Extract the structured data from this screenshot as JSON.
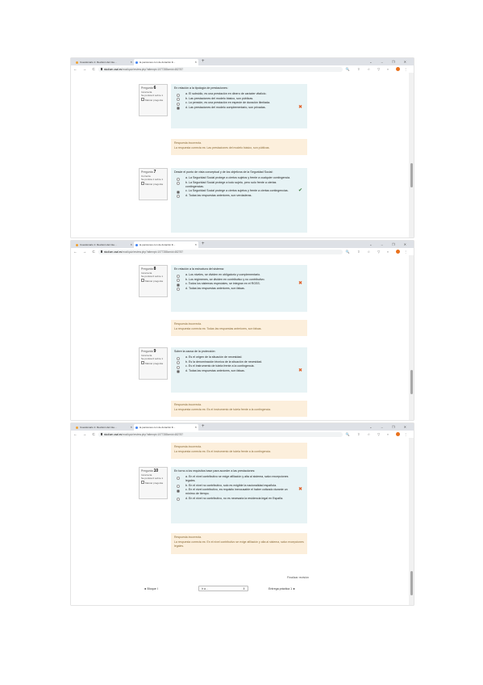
{
  "browser": {
    "tab1_title": "Cuestionario 1: Revisión del inte...",
    "tab2_title": "la pensiones con de duración ili...",
    "tab_close": "×",
    "new_tab": "+",
    "window_controls": "⌄  –  ❐  ✕",
    "nav_buttons": "←  →  C",
    "url_host": "studium.usal.es",
    "url_path": "/mod/quiz/review.php?attempt=1077288cmid=482787",
    "toolbar_icons": "🔍 ⇧ ☆ ▽ ▪"
  },
  "questions": [
    {
      "label": "Pregunta",
      "number": "6",
      "state": "Incorrecta",
      "score": "Se puntúa 0 sobre 1",
      "flag": "Marcar pregunta",
      "text": "En relación a la tipología de prestaciones:",
      "options": [
        {
          "letter": "a.",
          "text": "El subsidio, es una prestación en dinero de carácter vitalicio."
        },
        {
          "letter": "b.",
          "text": "Las prestaciones del modelo básico, son públicas."
        },
        {
          "letter": "c.",
          "text": "La pensión, es una prestación en especie de duración ilimitada."
        },
        {
          "letter": "d.",
          "text": "Las prestaciones del modelo complementario, son privadas.",
          "selected": true,
          "mark": "✖"
        }
      ],
      "feedback_title": "Respuesta incorrecta.",
      "feedback_text": "La respuesta correcta es: Las prestaciones del modelo básico, son públicas."
    },
    {
      "label": "Pregunta",
      "number": "7",
      "state": "Correcta",
      "score": "Se puntúa 1 sobre 1",
      "flag": "Marcar pregunta",
      "text": "Desde el punto de vista conceptual y de los objetivos de la Seguridad Social:",
      "options": [
        {
          "letter": "a.",
          "text": "La Seguridad Social protege a ciertos sujetos y frente a cualquier contingencia."
        },
        {
          "letter": "b.",
          "text": "La Seguridad Social protege a todo sujeto, pero solo frente a ciertas contingencias."
        },
        {
          "letter": "c.",
          "text": "La Seguridad Social protege a ciertos sujetos y frente a ciertas contingencias.",
          "selected": true,
          "mark": "✔"
        },
        {
          "letter": "d.",
          "text": "Todas las respuestas anteriores, son verdaderas."
        }
      ]
    },
    {
      "label": "Pregunta",
      "number": "8",
      "state": "Incorrecta",
      "score": "Se puntúa 0 sobre 1",
      "flag": "Marcar pregunta",
      "text": "En relación a la estructura del sistema:",
      "options": [
        {
          "letter": "a.",
          "text": "Los niveles, se dividen en obligatorio y complementario."
        },
        {
          "letter": "b.",
          "text": "Los regímenes, se dividen en contributivo y no contributivo."
        },
        {
          "letter": "c.",
          "text": "Todos los sistemas especiales, se integran en el RGSS.",
          "selected": true,
          "mark": "✖"
        },
        {
          "letter": "d.",
          "text": "Todas las respuestas anteriores, son falsas."
        }
      ],
      "feedback_title": "Respuesta incorrecta.",
      "feedback_text": "La respuesta correcta es: Todas las respuestas anteriores, son falsas."
    },
    {
      "label": "Pregunta",
      "number": "9",
      "state": "Incorrecta",
      "score": "Se puntúa 0 sobre 1",
      "flag": "Marcar pregunta",
      "text": "Sobre la causa de la protección:",
      "options": [
        {
          "letter": "a.",
          "text": "Es el origen de la situación de necesidad."
        },
        {
          "letter": "b.",
          "text": "Es la denominación técnica de la situación de necesidad."
        },
        {
          "letter": "c.",
          "text": "Es el instrumento de tutela frente a la contingencia."
        },
        {
          "letter": "d.",
          "text": "Todas las respuestas anteriores, son falsas.",
          "selected": true,
          "mark": "✖"
        }
      ],
      "feedback_title": "Respuesta incorrecta.",
      "feedback_text": "La respuesta correcta es: Es el instrumento de tutela frente a la contingencia."
    },
    {
      "label": "Pregunta",
      "number": "10",
      "state": "Incorrecta",
      "score": "Se puntúa 0 sobre 1",
      "flag": "Marcar pregunta",
      "text": "En torno a los requisitos base para acceder a las prestaciones:",
      "options": [
        {
          "letter": "a.",
          "text": "En el nivel contributivo se exige afiliación y alta al sistema, salvo excepciones legales."
        },
        {
          "letter": "b.",
          "text": "En el nivel no contributivo, solo es exigible la nacionalidad española."
        },
        {
          "letter": "c.",
          "text": "En el nivel contributivo, es requisito inexcusable el haber cotizado durante un mínimo de tiempo.",
          "selected": true,
          "mark": "✖"
        },
        {
          "letter": "d.",
          "text": "En el nivel no contributivo, no es necesaria la residencia legal en España."
        }
      ],
      "feedback_title": "Respuesta incorrecta.",
      "feedback_text": "La respuesta correcta es: En el nivel contributivo se exige afiliación y alta al sistema, salvo excepciones legales."
    }
  ],
  "footer": {
    "finish_review": "Finalizar revisión",
    "prev_link": "◄ Bloque I",
    "jump_label": "Ir a...",
    "jump_chevron": "⇕",
    "next_link": "Entrega práctica 1 ►"
  }
}
